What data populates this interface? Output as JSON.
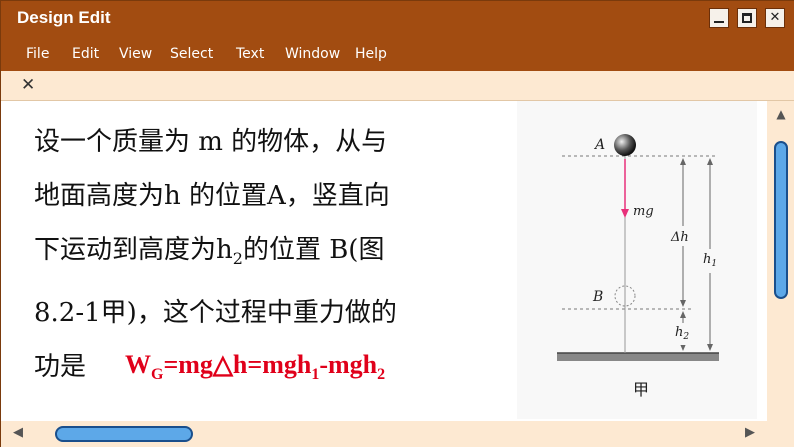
{
  "window": {
    "title": "Design Edit",
    "min_icon": "minimize-icon",
    "max_icon": "maximize-icon",
    "close_glyph": "✕"
  },
  "menu": [
    "File",
    "Edit",
    "View",
    "Select",
    "Text",
    "Window",
    "Help"
  ],
  "tab": {
    "close_glyph": "✕"
  },
  "slide": {
    "lines": [
      "设一个质量为 m 的物体，从与",
      "地面高度为h 的位置A，竖直向",
      "下运动到高度为h",
      "2",
      "的位置 B(图",
      "8.2-1甲)，这个过程中重力做的",
      "功是"
    ],
    "formula": {
      "w": "W",
      "g_sub": "G",
      "mid": "=mg△h=mgh",
      "sub1": "1",
      "minus": "-mgh",
      "sub2": "2"
    },
    "figure": {
      "label_a": "A",
      "label_b": "B",
      "label_mg": "mg",
      "label_dh": "Δh",
      "label_h1": "h",
      "label_h1_sub": "1",
      "label_h2": "h",
      "label_h2_sub": "2",
      "caption": "甲"
    }
  },
  "scroll": {
    "up": "▲",
    "down": "▼",
    "left": "◀",
    "right": "▶"
  },
  "colors": {
    "titlebar": "#a24c11",
    "tabstrip": "#fde9d2",
    "formula": "#e0001a",
    "scroll_thumb": "#5da8e8"
  }
}
